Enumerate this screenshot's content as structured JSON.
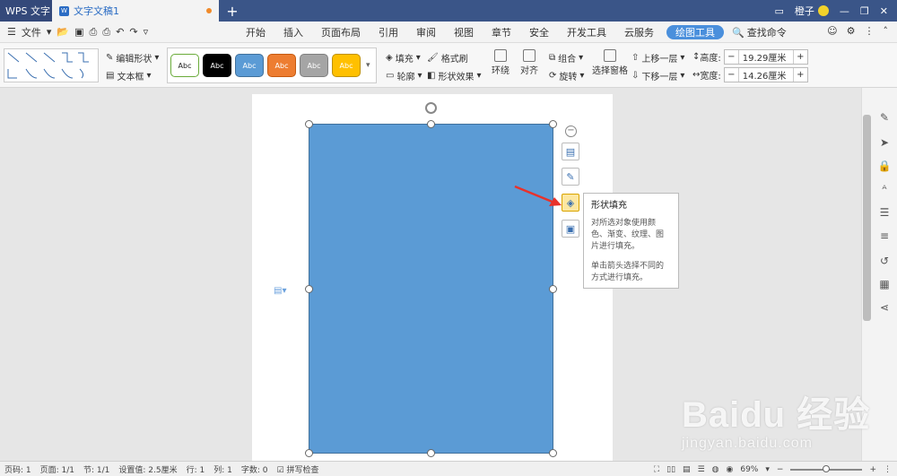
{
  "titlebar": {
    "app_name": "WPS 文字",
    "doc_tab": "文字文稿1",
    "new_tab": "+",
    "user_name": "橙子",
    "icons": [
      "window-icon",
      "minimize-icon",
      "restore-icon",
      "close-icon"
    ]
  },
  "menubar": {
    "file_label": "文件",
    "tabs": [
      {
        "label": "开始"
      },
      {
        "label": "插入"
      },
      {
        "label": "页面布局"
      },
      {
        "label": "引用"
      },
      {
        "label": "审阅"
      },
      {
        "label": "视图"
      },
      {
        "label": "章节"
      },
      {
        "label": "安全"
      },
      {
        "label": "开发工具"
      },
      {
        "label": "云服务"
      },
      {
        "label": "绘图工具",
        "active": true
      }
    ],
    "search_label": "查找命令"
  },
  "ribbon": {
    "edit_shape": "编辑形状",
    "text_box": "文本框",
    "styles": [
      {
        "label": "Abc",
        "bg": "#ffffff",
        "fg": "#222222",
        "border": "#6aab3a"
      },
      {
        "label": "Abc",
        "bg": "#000000",
        "fg": "#ffffff",
        "border": "#000000"
      },
      {
        "label": "Abc",
        "bg": "#5b9bd5",
        "fg": "#ffffff",
        "border": "#41719c"
      },
      {
        "label": "Abc",
        "bg": "#ed7d31",
        "fg": "#ffffff",
        "border": "#c55a11"
      },
      {
        "label": "Abc",
        "bg": "#a5a5a5",
        "fg": "#ffffff",
        "border": "#7f7f7f"
      },
      {
        "label": "Abc",
        "bg": "#ffc000",
        "fg": "#ffffff",
        "border": "#bf9000"
      }
    ],
    "fill": "填充",
    "format_painter": "格式刷",
    "outline": "轮廓",
    "shape_effects": "形状效果",
    "wrap": "环绕",
    "align": "对齐",
    "group": "组合",
    "rotate": "旋转",
    "selection_pane": "选择窗格",
    "bring_forward": "上移一层",
    "send_backward": "下移一层",
    "height_label": "高度:",
    "height_value": "19.29厘米",
    "width_label": "宽度:",
    "width_value": "14.26厘米"
  },
  "tooltip": {
    "title": "形状填充",
    "p1": "对所选对象使用颜色、渐变、纹理、图片进行填充。",
    "p2": "单击箭头选择不同的方式进行填充。"
  },
  "watermark": {
    "big": "Baidu 经验",
    "small": "jingyan.baidu.com"
  },
  "status": {
    "page_num": "页码: 1",
    "pages": "页面: 1/1",
    "section": "节: 1/1",
    "setting": "设置值: 2.5厘米",
    "row": "行: 1",
    "col": "列: 1",
    "words": "字数: 0",
    "spell": "拼写检查",
    "zoom": "69%"
  }
}
